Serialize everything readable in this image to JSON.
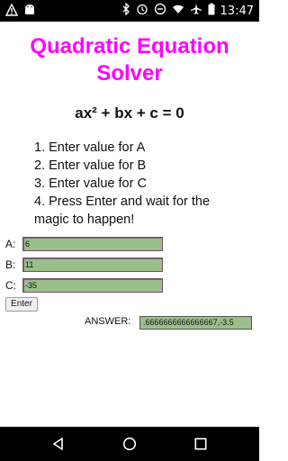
{
  "status_bar": {
    "time": "13:47",
    "left_icons": [
      "warning-icon",
      "android-icon"
    ],
    "right_icons": [
      "bluetooth-icon",
      "alarm-icon",
      "do-not-disturb-icon",
      "wifi-icon",
      "airplane-icon",
      "battery-icon"
    ]
  },
  "app": {
    "title_line1": "Quadratic Equation",
    "title_line2": "Solver",
    "equation": "ax² + bx + c = 0",
    "steps": [
      "1. Enter value for A",
      "2. Enter value for B",
      "3. Enter value for C",
      "4. Press Enter and wait for the",
      "magic to happen!"
    ],
    "fields": {
      "a_label": "A:",
      "a_value": "6",
      "b_label": "B:",
      "b_value": "11",
      "c_label": "C:",
      "c_value": "-35"
    },
    "enter_button": "Enter",
    "answer_label": "ANSWER:",
    "answer_value": ".6666666666666667,-3.5"
  },
  "nav": {
    "icons": [
      "back-icon",
      "home-icon",
      "recents-icon"
    ]
  },
  "colors": {
    "title": "#ff00ff",
    "field_bg": "#9bbf8a",
    "bars": "#000000"
  }
}
